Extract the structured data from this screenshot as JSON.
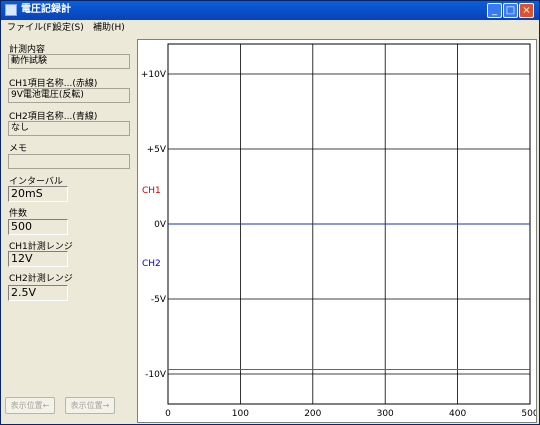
{
  "window": {
    "title": "電圧記録計",
    "min_label": "_",
    "max_label": "□",
    "close_label": "×"
  },
  "menu": [
    {
      "label": "ファイル(F)"
    },
    {
      "label": "設定(S)"
    },
    {
      "label": "補助(H)"
    }
  ],
  "sidebar": {
    "measure_label": "計測内容",
    "measure_value": "動作試験",
    "ch1_label": "CH1項目名称...(赤線)",
    "ch1_value": "9V電池電圧(反転)",
    "ch2_label": "CH2項目名称...(青線)",
    "ch2_value": "なし",
    "memo_label": "メモ",
    "memo_value": "",
    "interval_label": "インターバル",
    "interval_value": "20mS",
    "count_label": "件数",
    "count_value": "500",
    "ch1_range_label": "CH1計測レンジ",
    "ch1_range_value": "12V",
    "ch2_range_label": "CH2計測レンジ",
    "ch2_range_value": "2.5V",
    "btn_pos_back": "表示位置←",
    "btn_pos_fwd": "表示位置→"
  },
  "chart_data": {
    "type": "line",
    "xlim": [
      0,
      500
    ],
    "ylim": [
      -12,
      12
    ],
    "x_ticks": [
      "0",
      "100",
      "200",
      "300",
      "400",
      "500"
    ],
    "y_ticks": [
      {
        "value": 10,
        "label": "+10V"
      },
      {
        "value": 5,
        "label": "+5V"
      },
      {
        "value": 0,
        "label": "0V"
      },
      {
        "value": -5,
        "label": "-5V"
      },
      {
        "value": -10,
        "label": "-10V"
      }
    ],
    "channel_labels": [
      {
        "label": "CH1",
        "color": "#cc0000"
      },
      {
        "label": "CH2",
        "color": "#0000cc"
      }
    ],
    "grid": true,
    "series": [
      {
        "name": "CH1",
        "color": "#e03020",
        "x": [
          0,
          500
        ],
        "values": [
          -9.7,
          -9.7
        ]
      },
      {
        "name": "CH2",
        "color": "#1a2fb0",
        "x": [
          0,
          500
        ],
        "values": [
          0,
          0
        ]
      }
    ]
  }
}
